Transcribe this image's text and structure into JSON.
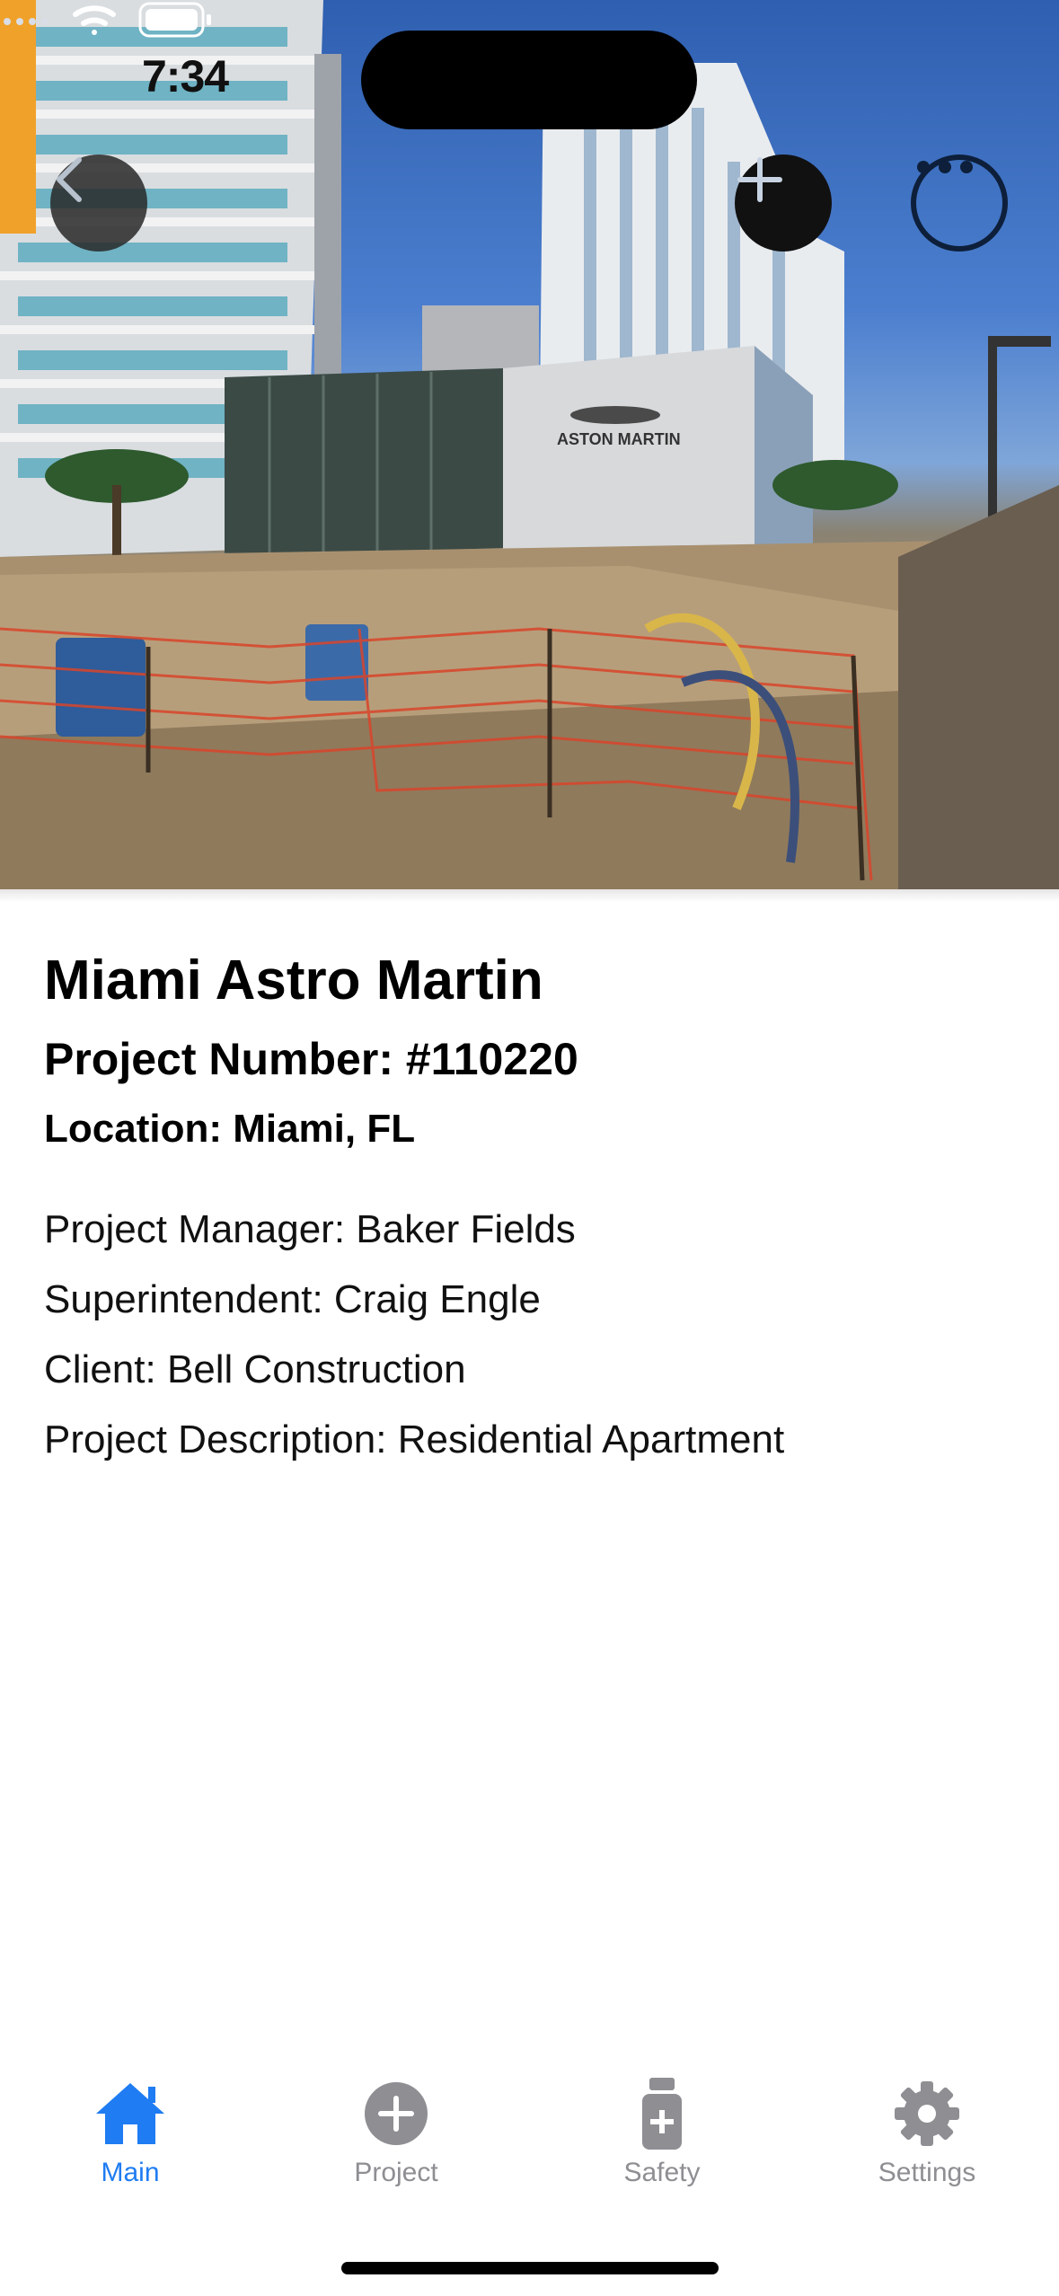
{
  "status_bar": {
    "time": "7:34"
  },
  "hero": {
    "image": "construction-site-photo",
    "sign_text": "ASTON MARTIN"
  },
  "project": {
    "name": "Miami Astro Martin",
    "number_line": "Project Number: #110220",
    "location_line": "Location: Miami, FL",
    "details": [
      "Project Manager: Baker Fields",
      "Superintendent: Craig Engle",
      "Client: Bell Construction",
      "Project Description: Residential Apartment"
    ]
  },
  "toolbar": {
    "back_icon": "chevron-left-icon",
    "add_icon": "plus-icon",
    "more_icon": "ellipsis-icon"
  },
  "tabs": [
    {
      "label": "Main",
      "icon": "house-icon",
      "active": true
    },
    {
      "label": "Project",
      "icon": "plus-circle-icon",
      "active": false
    },
    {
      "label": "Safety",
      "icon": "medicine-bottle-icon",
      "active": false
    },
    {
      "label": "Settings",
      "icon": "gear-icon",
      "active": false
    }
  ],
  "colors": {
    "accent": "#1f7cf2",
    "inactive": "#8e8e93"
  }
}
